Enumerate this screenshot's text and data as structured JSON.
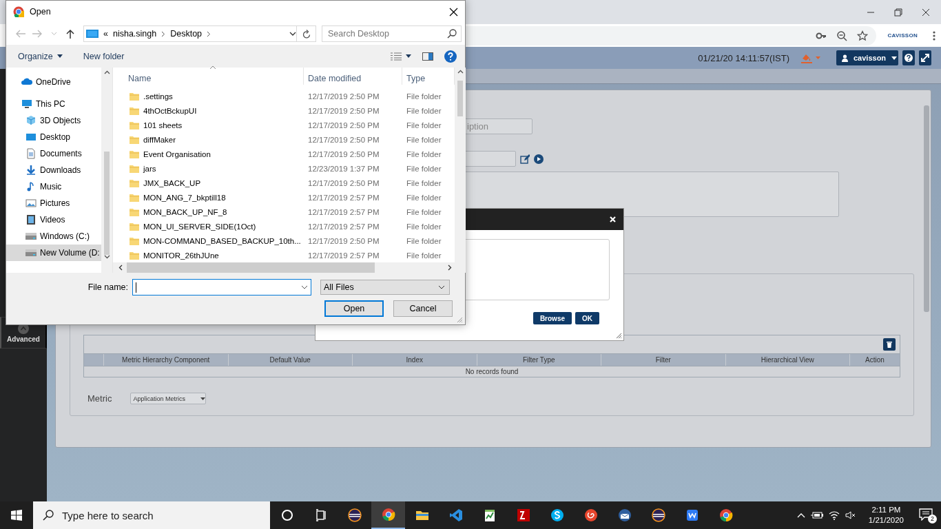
{
  "browser": {
    "profile_logo": "CAVISSON"
  },
  "app_header": {
    "datetime": "01/21/20 14:11:57(IST)",
    "user": "cavisson"
  },
  "sidebar": {
    "items": [
      {
        "label": "Advanced"
      }
    ]
  },
  "form": {
    "description_field": {
      "placeholder": "iption"
    }
  },
  "table": {
    "columns": [
      "Metric Hierarchy Component",
      "Default Value",
      "Index",
      "Filter Type",
      "Filter",
      "Hierarchical View",
      "Action"
    ],
    "empty_message": "No records found"
  },
  "metric": {
    "label": "Metric",
    "value": "Application Metrics"
  },
  "upload_modal": {
    "buttons": [
      "Browse",
      "OK"
    ]
  },
  "open_dialog": {
    "title": "Open",
    "path_prefix": "«",
    "path": [
      "nisha.singh",
      "Desktop"
    ],
    "search_placeholder": "Search Desktop",
    "commands": [
      "Organize",
      "New folder"
    ],
    "nav_items": [
      {
        "label": "OneDrive",
        "kind": "cloud",
        "selected": false
      },
      {
        "label": "This PC",
        "kind": "pc",
        "selected": false,
        "children": [
          {
            "label": "3D Objects",
            "kind": "cube",
            "selected": false
          },
          {
            "label": "Desktop",
            "kind": "desktop",
            "selected": false
          },
          {
            "label": "Documents",
            "kind": "document",
            "selected": false
          },
          {
            "label": "Downloads",
            "kind": "download",
            "selected": false
          },
          {
            "label": "Music",
            "kind": "music",
            "selected": false
          },
          {
            "label": "Pictures",
            "kind": "picture",
            "selected": false
          },
          {
            "label": "Videos",
            "kind": "video",
            "selected": false
          },
          {
            "label": "Windows (C:)",
            "kind": "drive",
            "selected": false
          },
          {
            "label": "New Volume (D:",
            "kind": "drive",
            "selected": true
          }
        ]
      }
    ],
    "columns": [
      "Name",
      "Date modified",
      "Type"
    ],
    "files": [
      {
        "name": ".settings",
        "date": "12/17/2019 2:50 PM",
        "type": "File folder"
      },
      {
        "name": "4thOctBckupUI",
        "date": "12/17/2019 2:50 PM",
        "type": "File folder"
      },
      {
        "name": "101 sheets",
        "date": "12/17/2019 2:50 PM",
        "type": "File folder"
      },
      {
        "name": "diffMaker",
        "date": "12/17/2019 2:50 PM",
        "type": "File folder"
      },
      {
        "name": "Event Organisation",
        "date": "12/17/2019 2:50 PM",
        "type": "File folder"
      },
      {
        "name": "jars",
        "date": "12/23/2019 1:37 PM",
        "type": "File folder"
      },
      {
        "name": "JMX_BACK_UP",
        "date": "12/17/2019 2:50 PM",
        "type": "File folder"
      },
      {
        "name": "MON_ANG_7_bkptill18",
        "date": "12/17/2019 2:57 PM",
        "type": "File folder"
      },
      {
        "name": "MON_BACK_UP_NF_8",
        "date": "12/17/2019 2:57 PM",
        "type": "File folder"
      },
      {
        "name": "MON_UI_SERVER_SIDE(1Oct)",
        "date": "12/17/2019 2:57 PM",
        "type": "File folder"
      },
      {
        "name": "MON-COMMAND_BASED_BACKUP_10th...",
        "date": "12/17/2019 2:50 PM",
        "type": "File folder"
      },
      {
        "name": "MONITOR_26thJUne",
        "date": "12/17/2019 2:57 PM",
        "type": "File folder"
      }
    ],
    "file_name_label": "File name:",
    "file_type": "All Files",
    "buttons": [
      "Open",
      "Cancel"
    ]
  },
  "taskbar": {
    "search_placeholder": "Type here to search",
    "apps": [
      {
        "kind": "cortana",
        "active": false
      },
      {
        "kind": "taskview",
        "active": false
      },
      {
        "kind": "eclipse",
        "active": false
      },
      {
        "kind": "chrome",
        "active": true
      },
      {
        "kind": "explorer",
        "active": false
      },
      {
        "kind": "vscode",
        "active": false
      },
      {
        "kind": "notepad",
        "active": false
      },
      {
        "kind": "filezilla",
        "active": false
      },
      {
        "kind": "skype",
        "active": false
      },
      {
        "kind": "snail",
        "active": false
      },
      {
        "kind": "mail",
        "active": false
      },
      {
        "kind": "eclipse",
        "active": false
      },
      {
        "kind": "wps",
        "active": false
      },
      {
        "kind": "chrome",
        "active": false
      }
    ],
    "time": "2:11 PM",
    "date": "1/21/2020",
    "notifications": "2"
  }
}
